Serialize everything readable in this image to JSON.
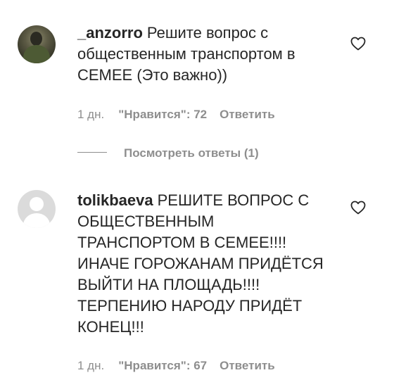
{
  "comments": [
    {
      "username": "_anzorro",
      "text": "Решите вопрос с общественным транспортом в СЕМЕЕ (Это важно))",
      "time": "1 дн.",
      "likes": "\"Нравится\": 72",
      "reply_label": "Ответить",
      "avatar": "user-photo"
    },
    {
      "username": "tolikbaeva",
      "text": "РЕШИТЕ ВОПРОС С ОБЩЕСТВЕННЫМ ТРАНСПОРТОМ В СЕМЕЕ!!!! ИНАЧЕ ГОРОЖАНАМ ПРИДЁТСЯ ВЫЙТИ НА ПЛОЩАДЬ!!!! ТЕРПЕНИЮ НАРОДУ ПРИДЁТ КОНЕЦ!!!",
      "time": "1 дн.",
      "likes": "\"Нравится\": 67",
      "reply_label": "Ответить",
      "avatar": "default-avatar"
    }
  ],
  "view_replies": "Посмотреть ответы (1)",
  "icons": {
    "like": "heart-outline-icon"
  },
  "colors": {
    "text": "#262626",
    "secondary": "#8e8e8e",
    "background": "#ffffff"
  }
}
